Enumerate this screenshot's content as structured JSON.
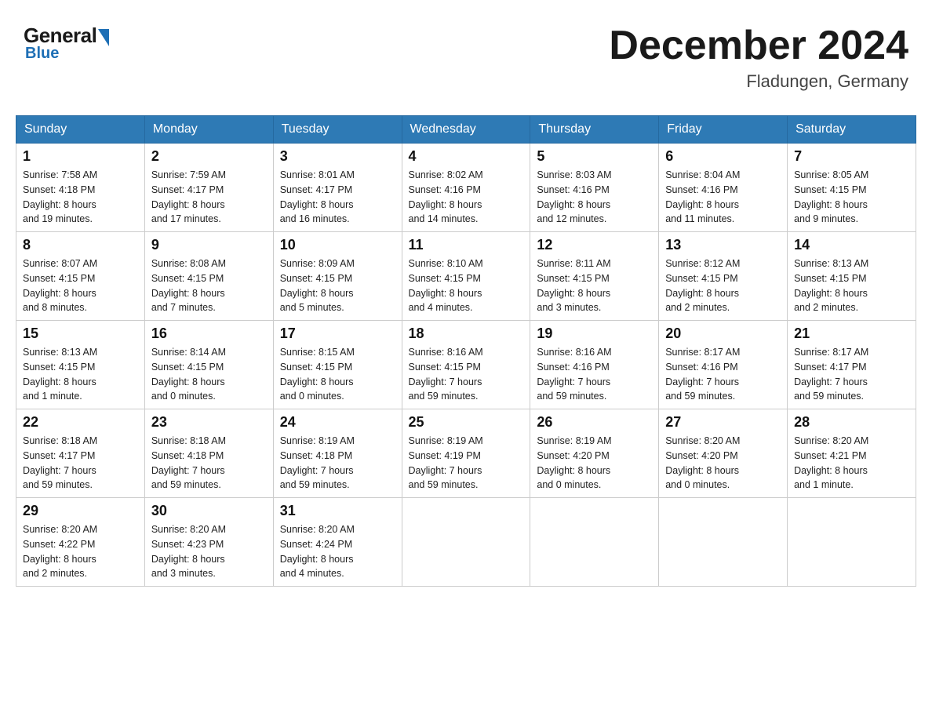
{
  "header": {
    "logo_general": "General",
    "logo_blue": "Blue",
    "month_title": "December 2024",
    "location": "Fladungen, Germany"
  },
  "days_of_week": [
    "Sunday",
    "Monday",
    "Tuesday",
    "Wednesday",
    "Thursday",
    "Friday",
    "Saturday"
  ],
  "weeks": [
    [
      {
        "day": "1",
        "sunrise": "7:58 AM",
        "sunset": "4:18 PM",
        "daylight": "8 hours and 19 minutes."
      },
      {
        "day": "2",
        "sunrise": "7:59 AM",
        "sunset": "4:17 PM",
        "daylight": "8 hours and 17 minutes."
      },
      {
        "day": "3",
        "sunrise": "8:01 AM",
        "sunset": "4:17 PM",
        "daylight": "8 hours and 16 minutes."
      },
      {
        "day": "4",
        "sunrise": "8:02 AM",
        "sunset": "4:16 PM",
        "daylight": "8 hours and 14 minutes."
      },
      {
        "day": "5",
        "sunrise": "8:03 AM",
        "sunset": "4:16 PM",
        "daylight": "8 hours and 12 minutes."
      },
      {
        "day": "6",
        "sunrise": "8:04 AM",
        "sunset": "4:16 PM",
        "daylight": "8 hours and 11 minutes."
      },
      {
        "day": "7",
        "sunrise": "8:05 AM",
        "sunset": "4:15 PM",
        "daylight": "8 hours and 9 minutes."
      }
    ],
    [
      {
        "day": "8",
        "sunrise": "8:07 AM",
        "sunset": "4:15 PM",
        "daylight": "8 hours and 8 minutes."
      },
      {
        "day": "9",
        "sunrise": "8:08 AM",
        "sunset": "4:15 PM",
        "daylight": "8 hours and 7 minutes."
      },
      {
        "day": "10",
        "sunrise": "8:09 AM",
        "sunset": "4:15 PM",
        "daylight": "8 hours and 5 minutes."
      },
      {
        "day": "11",
        "sunrise": "8:10 AM",
        "sunset": "4:15 PM",
        "daylight": "8 hours and 4 minutes."
      },
      {
        "day": "12",
        "sunrise": "8:11 AM",
        "sunset": "4:15 PM",
        "daylight": "8 hours and 3 minutes."
      },
      {
        "day": "13",
        "sunrise": "8:12 AM",
        "sunset": "4:15 PM",
        "daylight": "8 hours and 2 minutes."
      },
      {
        "day": "14",
        "sunrise": "8:13 AM",
        "sunset": "4:15 PM",
        "daylight": "8 hours and 2 minutes."
      }
    ],
    [
      {
        "day": "15",
        "sunrise": "8:13 AM",
        "sunset": "4:15 PM",
        "daylight": "8 hours and 1 minute."
      },
      {
        "day": "16",
        "sunrise": "8:14 AM",
        "sunset": "4:15 PM",
        "daylight": "8 hours and 0 minutes."
      },
      {
        "day": "17",
        "sunrise": "8:15 AM",
        "sunset": "4:15 PM",
        "daylight": "8 hours and 0 minutes."
      },
      {
        "day": "18",
        "sunrise": "8:16 AM",
        "sunset": "4:15 PM",
        "daylight": "7 hours and 59 minutes."
      },
      {
        "day": "19",
        "sunrise": "8:16 AM",
        "sunset": "4:16 PM",
        "daylight": "7 hours and 59 minutes."
      },
      {
        "day": "20",
        "sunrise": "8:17 AM",
        "sunset": "4:16 PM",
        "daylight": "7 hours and 59 minutes."
      },
      {
        "day": "21",
        "sunrise": "8:17 AM",
        "sunset": "4:17 PM",
        "daylight": "7 hours and 59 minutes."
      }
    ],
    [
      {
        "day": "22",
        "sunrise": "8:18 AM",
        "sunset": "4:17 PM",
        "daylight": "7 hours and 59 minutes."
      },
      {
        "day": "23",
        "sunrise": "8:18 AM",
        "sunset": "4:18 PM",
        "daylight": "7 hours and 59 minutes."
      },
      {
        "day": "24",
        "sunrise": "8:19 AM",
        "sunset": "4:18 PM",
        "daylight": "7 hours and 59 minutes."
      },
      {
        "day": "25",
        "sunrise": "8:19 AM",
        "sunset": "4:19 PM",
        "daylight": "7 hours and 59 minutes."
      },
      {
        "day": "26",
        "sunrise": "8:19 AM",
        "sunset": "4:20 PM",
        "daylight": "8 hours and 0 minutes."
      },
      {
        "day": "27",
        "sunrise": "8:20 AM",
        "sunset": "4:20 PM",
        "daylight": "8 hours and 0 minutes."
      },
      {
        "day": "28",
        "sunrise": "8:20 AM",
        "sunset": "4:21 PM",
        "daylight": "8 hours and 1 minute."
      }
    ],
    [
      {
        "day": "29",
        "sunrise": "8:20 AM",
        "sunset": "4:22 PM",
        "daylight": "8 hours and 2 minutes."
      },
      {
        "day": "30",
        "sunrise": "8:20 AM",
        "sunset": "4:23 PM",
        "daylight": "8 hours and 3 minutes."
      },
      {
        "day": "31",
        "sunrise": "8:20 AM",
        "sunset": "4:24 PM",
        "daylight": "8 hours and 4 minutes."
      },
      null,
      null,
      null,
      null
    ]
  ],
  "labels": {
    "sunrise": "Sunrise:",
    "sunset": "Sunset:",
    "daylight": "Daylight:"
  }
}
